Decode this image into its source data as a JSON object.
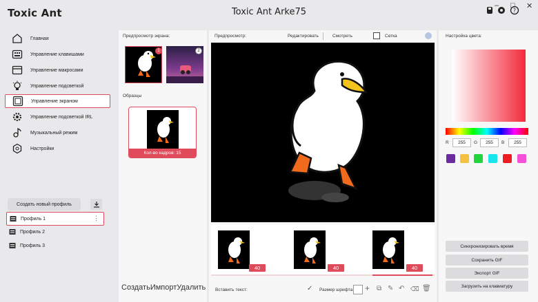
{
  "app": {
    "logo": "Toxic Ant",
    "title": "Toxic Ant Arke75"
  },
  "window": {
    "minimize": "–",
    "maximize": "□",
    "close": "✕"
  },
  "sidebar": {
    "items": [
      {
        "label": "Главная",
        "icon": "home-icon",
        "active": false
      },
      {
        "label": "Управление клавишами",
        "icon": "keyboard-icon",
        "active": false
      },
      {
        "label": "Управление макросами",
        "icon": "macro-icon",
        "active": false
      },
      {
        "label": "Управление подсветкой",
        "icon": "bulb-icon",
        "active": false
      },
      {
        "label": "Управление экраном",
        "icon": "screen-icon",
        "active": true
      },
      {
        "label": "Управление подсветкой IRL",
        "icon": "gear-icon",
        "active": false
      },
      {
        "label": "Музыкальный режим",
        "icon": "music-icon",
        "active": false
      },
      {
        "label": "Настройки",
        "icon": "settings-icon",
        "active": false
      }
    ],
    "create_profile": "Создать новый профиль",
    "profiles": [
      "Профиль 1",
      "Профиль 2",
      "Профиль 3"
    ],
    "profile_menu": "⋮"
  },
  "left_panel": {
    "title": "Предпросмотр экрана:",
    "thumb_badges": [
      "1",
      "2"
    ],
    "samples_title": "Образцы",
    "sample_frames": "Кол-во кадров: 15",
    "actions": {
      "create": "Создать",
      "import": "Импорт",
      "delete": "Удалить"
    }
  },
  "center": {
    "preview_label": "Предпросмотр:",
    "edit_label": "Редактировать",
    "view_label": "Смотреть",
    "grid_label": "Сетка",
    "frames": [
      {
        "duration": "40"
      },
      {
        "duration": "40"
      },
      {
        "duration": "40"
      }
    ],
    "insert_text_label": "Вставить текст:",
    "font_size_label": "Размер шрифта"
  },
  "right": {
    "title": "Настройка цвета:",
    "r_label": "R",
    "g_label": "G",
    "b_label": "B",
    "r": "255",
    "g": "255",
    "b": "255",
    "swatches": [
      "#6b2ca0",
      "#f5c141",
      "#24d43d",
      "#19e6ec",
      "#ee1c24",
      "#f54fd8"
    ],
    "buttons": {
      "sync_time": "Синхронизировать время",
      "save_gif": "Сохранить GIF",
      "export_gif": "Экспорт GIF",
      "upload": "Загрузить на клавиатуру"
    }
  },
  "colors": {
    "accent": "#e04b5b",
    "background": "#e9e9ec",
    "panel": "#f7f7f8"
  }
}
